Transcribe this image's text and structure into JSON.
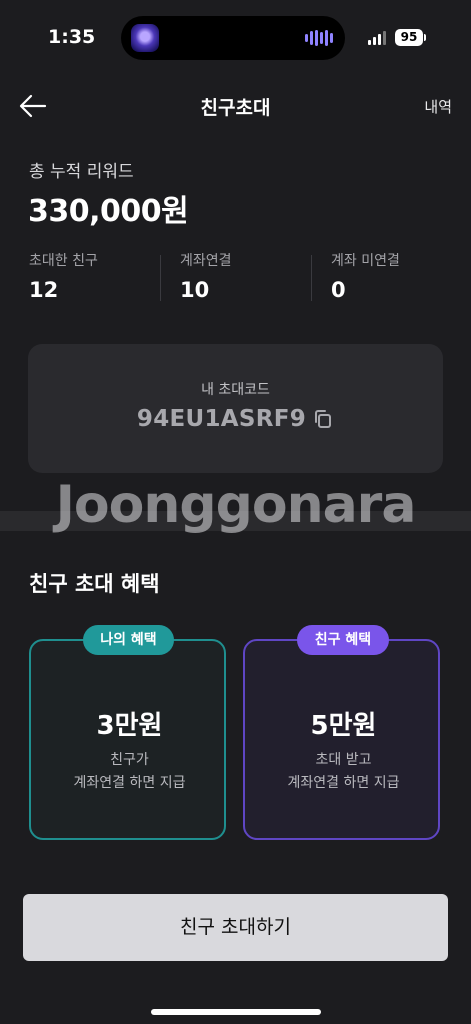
{
  "status_bar": {
    "time": "1:35",
    "battery": "95",
    "icons": [
      "dynamic-island-app-icon",
      "audio-wave-icon",
      "signal-icon",
      "battery-icon"
    ]
  },
  "header": {
    "title": "친구초대",
    "back_icon": "arrow-left-icon",
    "history_label": "내역"
  },
  "summary": {
    "total_label": "총 누적 리워드",
    "total_value": "330,000원",
    "stats": [
      {
        "label": "초대한 친구",
        "value": "12"
      },
      {
        "label": "계좌연결",
        "value": "10"
      },
      {
        "label": "계좌 미연결",
        "value": "0"
      }
    ]
  },
  "invite_code": {
    "label": "내 초대코드",
    "code": "94EU1ASRF9",
    "copy_icon": "copy-icon"
  },
  "watermark": "Joonggonara",
  "benefits": {
    "title": "친구 초대 혜택",
    "cards": [
      {
        "badge": "나의 혜택",
        "amount": "3만원",
        "desc1": "친구가",
        "desc2": "계좌연결 하면 지급",
        "accent": "#20999a"
      },
      {
        "badge": "친구 혜택",
        "amount": "5만원",
        "desc1": "초대 받고",
        "desc2": "계좌연결 하면 지급",
        "accent": "#7a55ea"
      }
    ]
  },
  "cta": {
    "label": "친구 초대하기"
  },
  "colors": {
    "background": "#1c1c1f",
    "card": "#2a2a2e",
    "teal": "#20999a",
    "purple": "#7a55ea",
    "button": "#d9d9dd"
  }
}
